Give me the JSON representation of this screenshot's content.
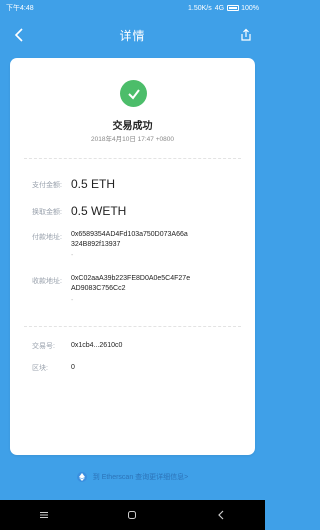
{
  "status_bar": {
    "time": "下午4:48",
    "network": "1.50K/s",
    "battery": "100%",
    "lte": "4G"
  },
  "header": {
    "title": "详情"
  },
  "tx": {
    "status": "交易成功",
    "timestamp": "2018年4月10日 17:47 +0800",
    "pay_label": "支付金额:",
    "pay_value": "0.5 ETH",
    "swap_label": "换取金额:",
    "swap_value": "0.5 WETH",
    "from_label": "付款地址:",
    "from_value": "0x6589354AD4Fd103a750D073A66a324B892f13937",
    "to_label": "收款地址:",
    "to_value": "0xC02aaA39b223FE8D0A0e5C4F27eAD9083C756Cc2",
    "hash_label": "交易号:",
    "hash_value": "0x1cb4...2610c0",
    "block_label": "区块:",
    "block_value": "0",
    "from_dot": "-",
    "to_dot": "-"
  },
  "footer": {
    "link_text": "到 Etherscan 查询更详细信息>"
  },
  "colors": {
    "primary": "#3fa0e8",
    "success": "#4cbd6a",
    "link": "#2c73b8"
  },
  "icons": [
    "back-icon",
    "share-icon",
    "check-icon",
    "ethereum-icon",
    "menu-icon",
    "home-icon",
    "nav-back-icon"
  ]
}
